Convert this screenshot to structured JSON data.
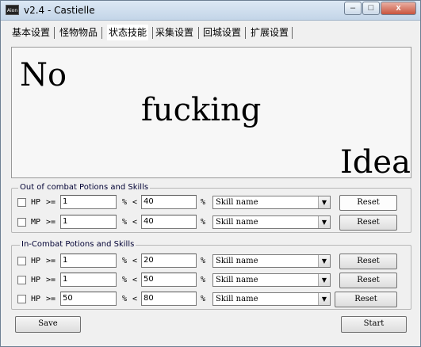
{
  "window": {
    "title": "v2.4 - Castielle",
    "icon_text": "Aion",
    "controls": {
      "minimize": "–",
      "maximize": "□",
      "close": "x"
    }
  },
  "tabs": [
    {
      "label": "基本设置"
    },
    {
      "label": "怪物物品"
    },
    {
      "label": "状态技能"
    },
    {
      "label": "采集设置"
    },
    {
      "label": "回城设置"
    },
    {
      "label": "扩展设置"
    }
  ],
  "active_tab": "状态技能",
  "banner": {
    "line1": "No",
    "line2": "fucking",
    "line3": "Idea"
  },
  "out_of_combat": {
    "label": "Out of combat Potions and Skills",
    "rows": [
      {
        "stat": "HP",
        "cmp": ">=",
        "min": "1",
        "pct": "%",
        "lt": "<",
        "max": "40",
        "pct2": "%",
        "skill": "Skill name",
        "reset": "Reset"
      },
      {
        "stat": "MP",
        "cmp": ">=",
        "min": "1",
        "pct": "%",
        "lt": "<",
        "max": "40",
        "pct2": "%",
        "skill": "Skill name",
        "reset": "Reset"
      }
    ]
  },
  "in_combat": {
    "label": "In-Combat Potions and Skills",
    "rows": [
      {
        "stat": "HP",
        "cmp": ">=",
        "min": "1",
        "pct": "%",
        "lt": "<",
        "max": "20",
        "pct2": "%",
        "skill": "Skill name",
        "reset": "Reset"
      },
      {
        "stat": "HP",
        "cmp": ">=",
        "min": "1",
        "pct": "%",
        "lt": "<",
        "max": "50",
        "pct2": "%",
        "skill": "Skill name",
        "reset": "Reset"
      },
      {
        "stat": "HP",
        "cmp": ">=",
        "min": "50",
        "pct": "%",
        "lt": "<",
        "max": "80",
        "pct2": "%",
        "skill": "Skill name",
        "reset": "Reset"
      }
    ]
  },
  "footer": {
    "save": "Save",
    "start": "Start"
  }
}
